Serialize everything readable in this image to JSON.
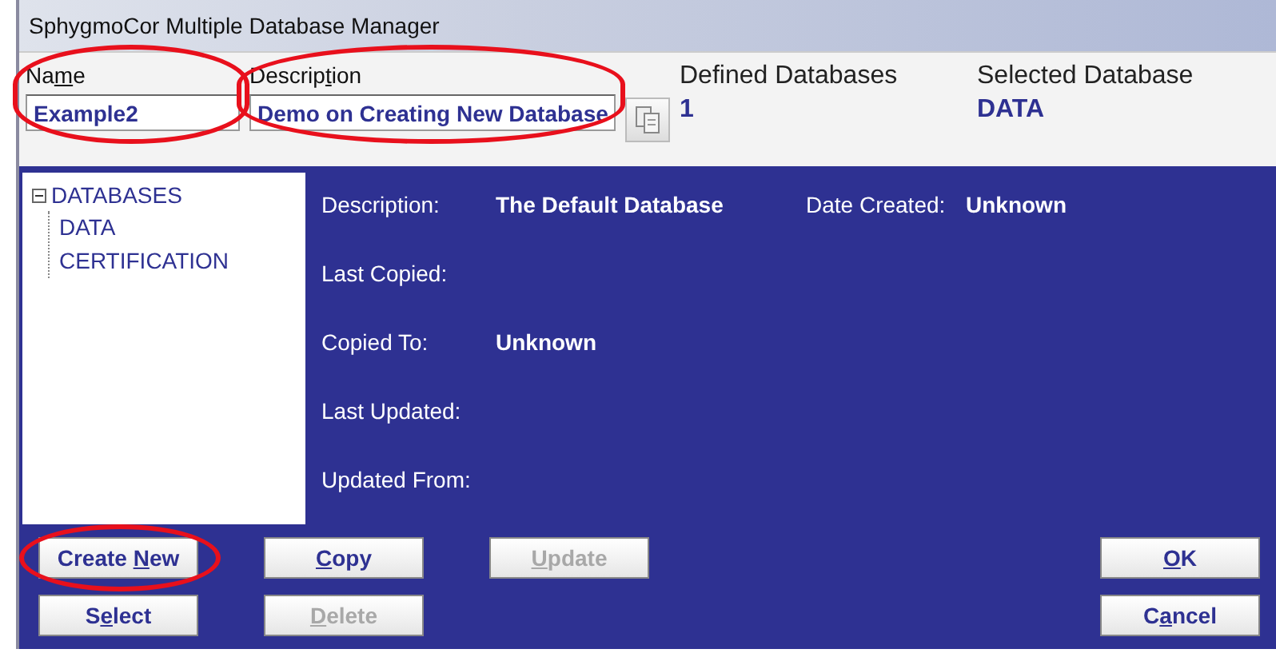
{
  "window": {
    "title": "SphygmoCor Multiple Database Manager"
  },
  "name_field": {
    "label_parts": [
      {
        "text": "Na",
        "underlined": false
      },
      {
        "text": "m",
        "underlined": true
      },
      {
        "text": "e",
        "underlined": false
      }
    ],
    "value": "Example2",
    "highlighted": true
  },
  "description_field": {
    "label_parts": [
      {
        "text": "Descrip",
        "underlined": false
      },
      {
        "text": "t",
        "underlined": true
      },
      {
        "text": "ion",
        "underlined": false
      }
    ],
    "value": "Demo on Creating New Database",
    "highlighted": true
  },
  "defined_databases": {
    "label": "Defined Databases",
    "value": "1"
  },
  "selected_database": {
    "label": "Selected Database",
    "value": "DATA"
  },
  "tree": {
    "label": "DATABASES",
    "expanded": true,
    "children": [
      {
        "label": "DATA"
      },
      {
        "label": "CERTIFICATION"
      }
    ]
  },
  "details": [
    {
      "label": "Description:",
      "value": "The Default Database",
      "extra_label": "Date Created:",
      "extra_value": "Unknown"
    },
    {
      "label": "Last Copied:"
    },
    {
      "label": "Copied To:",
      "value": "Unknown"
    },
    {
      "label": "Last Updated:"
    },
    {
      "label": "Updated From:"
    }
  ],
  "buttons_row_1": [
    {
      "label_parts": [
        {
          "text": "Create ",
          "underlined": false
        },
        {
          "text": "N",
          "underlined": true
        },
        {
          "text": "ew",
          "underlined": false
        }
      ],
      "disabled": false,
      "highlighted": true
    },
    {
      "label_parts": [
        {
          "text": "C",
          "underlined": true
        },
        {
          "text": "opy",
          "underlined": false
        }
      ],
      "disabled": false,
      "highlighted": false
    },
    {
      "label_parts": [
        {
          "text": "U",
          "underlined": true
        },
        {
          "text": "pdate",
          "underlined": false
        }
      ],
      "disabled": true,
      "highlighted": false
    }
  ],
  "buttons_row_2": [
    {
      "label_parts": [
        {
          "text": "S",
          "underlined": false
        },
        {
          "text": "e",
          "underlined": true
        },
        {
          "text": "lect",
          "underlined": false
        }
      ],
      "disabled": false,
      "highlighted": false
    },
    {
      "label_parts": [
        {
          "text": "D",
          "underlined": true
        },
        {
          "text": "elete",
          "underlined": false
        }
      ],
      "disabled": true,
      "highlighted": false
    }
  ],
  "buttons_right": [
    {
      "label_parts": [
        {
          "text": "O",
          "underlined": true
        },
        {
          "text": "K",
          "underlined": false
        }
      ],
      "disabled": false,
      "highlighted": false
    },
    {
      "label_parts": [
        {
          "text": "C",
          "underlined": false
        },
        {
          "text": "a",
          "underlined": true
        },
        {
          "text": "ncel",
          "underlined": false
        }
      ],
      "disabled": false,
      "highlighted": false
    }
  ]
}
